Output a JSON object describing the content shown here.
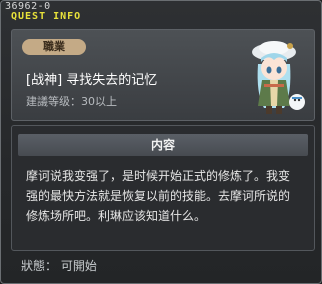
{
  "window": {
    "id_label": "36962-0",
    "title": "QUEST INFO"
  },
  "quest": {
    "job_badge": "職業",
    "name": "[战神] 寻找失去的记忆",
    "recommended_level": "建議等级：30以上",
    "npc_icon": "npc-portrait-icon"
  },
  "content": {
    "header": "内容",
    "lines": [
      "摩诃说我变强了，是时候开始正式的修炼了。我变",
      "强的最快方法就是恢复以前的技能。去摩诃所说的",
      "修炼场所吧。利琳应该知道什么。"
    ]
  },
  "status": {
    "text": "狀態： 可開始"
  },
  "colors": {
    "title_yellow": "#e8e23a",
    "badge_tan": "#c4aa86"
  }
}
